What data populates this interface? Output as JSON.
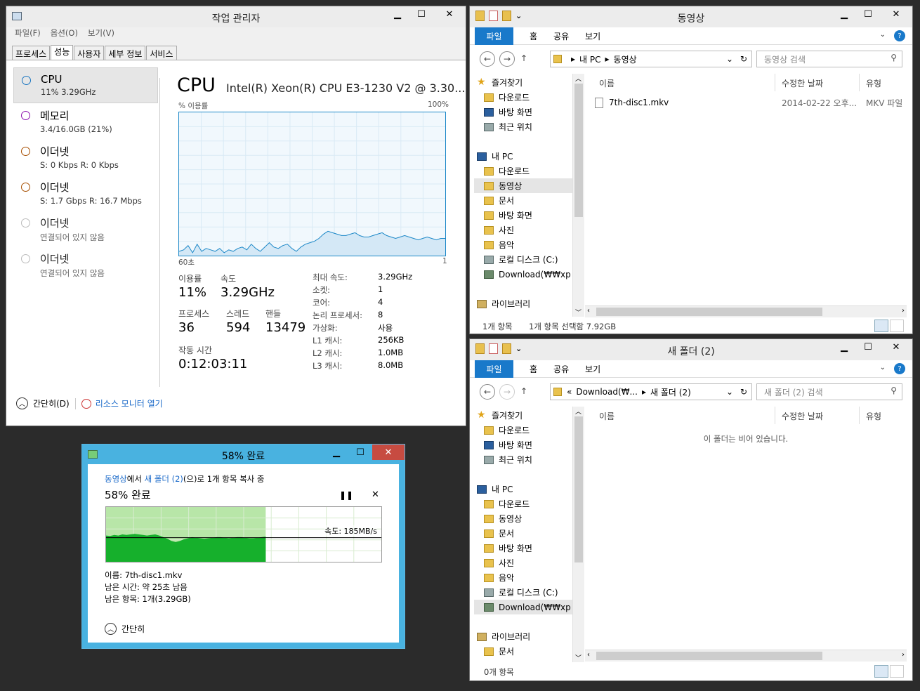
{
  "task_manager": {
    "title": "작업 관리자",
    "menu": [
      "파일(F)",
      "옵션(O)",
      "보기(V)"
    ],
    "tabs": [
      "프로세스",
      "성능",
      "사용자",
      "세부 정보",
      "서비스"
    ],
    "active_tab": "성능",
    "side": [
      {
        "name": "CPU",
        "sub": "11% 3.29GHz",
        "color": "#1874c0"
      },
      {
        "name": "메모리",
        "sub": "3.4/16.0GB (21%)",
        "color": "#8b12ae"
      },
      {
        "name": "이더넷",
        "sub": "S: 0 Kbps R: 0 Kbps",
        "color": "#a74f01"
      },
      {
        "name": "이더넷",
        "sub": "S: 1.7 Gbps R: 16.7 Mbps",
        "color": "#a74f01"
      },
      {
        "name": "이더넷",
        "sub": "연결되어 있지 않음",
        "color": "#bbbbbb"
      },
      {
        "name": "이더넷",
        "sub": "연결되어 있지 않음",
        "color": "#bbbbbb"
      }
    ],
    "cpu_title": "CPU",
    "cpu_model": "Intel(R) Xeon(R) CPU E3-1230 V2 @ 3.30...",
    "graph_label_left": "% 이용률",
    "graph_label_right": "100%",
    "graph_bottom_left": "60초",
    "graph_bottom_right": "1",
    "cpu_usage_history": [
      3,
      4,
      7,
      2,
      8,
      3,
      5,
      4,
      3,
      5,
      2,
      4,
      3,
      5,
      6,
      4,
      8,
      5,
      3,
      6,
      9,
      6,
      5,
      7,
      8,
      5,
      3,
      6,
      8,
      9,
      10,
      12,
      15,
      17,
      16,
      15,
      14,
      14,
      15,
      16,
      14,
      13,
      13,
      14,
      15,
      16,
      14,
      13,
      12,
      13,
      14,
      13,
      12,
      11,
      12,
      13,
      12,
      11,
      12,
      12
    ],
    "usage_label": "이용률",
    "usage_value": "11%",
    "speed_label": "속도",
    "speed_value": "3.29GHz",
    "proc_label": "프로세스",
    "proc_value": "36",
    "thread_label": "스레드",
    "thread_value": "594",
    "handle_label": "핸들",
    "handle_value": "13479",
    "uptime_label": "작동 시간",
    "uptime_value": "0:12:03:11",
    "specs_keys": [
      "최대 속도:",
      "소켓:",
      "코어:",
      "논리 프로세서:",
      "가상화:",
      "L1 캐시:",
      "L2 캐시:",
      "L3 캐시:"
    ],
    "specs_values": [
      "3.29GHz",
      "1",
      "4",
      "8",
      "사용",
      "256KB",
      "1.0MB",
      "8.0MB"
    ],
    "fewer_details": "간단히(D)",
    "resource_monitor": "리소스 모니터 열기"
  },
  "explorer1": {
    "title": "동영상",
    "ribbon": {
      "file": "파일",
      "tabs": [
        "홈",
        "공유",
        "보기"
      ]
    },
    "address": [
      "내 PC",
      "동영상"
    ],
    "search_placeholder": "동영상 검색",
    "nav": [
      {
        "label": "즐겨찾기",
        "icon": "star-icon",
        "indent": 0
      },
      {
        "label": "다운로드",
        "icon": "downloads-folder-icon",
        "indent": 1
      },
      {
        "label": "바탕 화면",
        "icon": "desktop-icon",
        "indent": 1
      },
      {
        "label": "최근 위치",
        "icon": "recent-places-icon",
        "indent": 1
      },
      {
        "label": "",
        "icon": "",
        "indent": 0
      },
      {
        "label": "내 PC",
        "icon": "pc-icon",
        "indent": 0
      },
      {
        "label": "다운로드",
        "icon": "downloads-folder-icon",
        "indent": 1
      },
      {
        "label": "동영상",
        "icon": "videos-folder-icon",
        "indent": 1,
        "selected": true
      },
      {
        "label": "문서",
        "icon": "documents-folder-icon",
        "indent": 1
      },
      {
        "label": "바탕 화면",
        "icon": "desktop-folder-icon",
        "indent": 1
      },
      {
        "label": "사진",
        "icon": "pictures-folder-icon",
        "indent": 1
      },
      {
        "label": "음악",
        "icon": "music-folder-icon",
        "indent": 1
      },
      {
        "label": "로컬 디스크 (C:)",
        "icon": "drive-icon",
        "indent": 1
      },
      {
        "label": "Download(₩₩xp",
        "icon": "network-drive-icon",
        "indent": 1
      },
      {
        "label": "",
        "icon": "",
        "indent": 0
      },
      {
        "label": "라이브러리",
        "icon": "library-icon",
        "indent": 0
      }
    ],
    "columns": [
      "이름",
      "수정한 날짜",
      "유형"
    ],
    "files": [
      {
        "name": "7th-disc1.mkv",
        "date": "2014-02-22 오후...",
        "type": "MKV 파일"
      }
    ],
    "status_count": "1개 항목",
    "status_selected": "1개 항목 선택함 7.92GB"
  },
  "explorer2": {
    "title": "새 폴더 (2)",
    "ribbon": {
      "file": "파일",
      "tabs": [
        "홈",
        "공유",
        "보기"
      ]
    },
    "address": [
      "«",
      "Download(₩...",
      "새 폴더 (2)"
    ],
    "search_placeholder": "새 폴더 (2) 검색",
    "nav": [
      {
        "label": "즐겨찾기",
        "icon": "star-icon",
        "indent": 0
      },
      {
        "label": "다운로드",
        "icon": "downloads-folder-icon",
        "indent": 1
      },
      {
        "label": "바탕 화면",
        "icon": "desktop-icon",
        "indent": 1
      },
      {
        "label": "최근 위치",
        "icon": "recent-places-icon",
        "indent": 1
      },
      {
        "label": "",
        "icon": "",
        "indent": 0
      },
      {
        "label": "내 PC",
        "icon": "pc-icon",
        "indent": 0
      },
      {
        "label": "다운로드",
        "icon": "downloads-folder-icon",
        "indent": 1
      },
      {
        "label": "동영상",
        "icon": "videos-folder-icon",
        "indent": 1
      },
      {
        "label": "문서",
        "icon": "documents-folder-icon",
        "indent": 1
      },
      {
        "label": "바탕 화면",
        "icon": "desktop-folder-icon",
        "indent": 1
      },
      {
        "label": "사진",
        "icon": "pictures-folder-icon",
        "indent": 1
      },
      {
        "label": "음악",
        "icon": "music-folder-icon",
        "indent": 1
      },
      {
        "label": "로컬 디스크 (C:)",
        "icon": "drive-icon",
        "indent": 1
      },
      {
        "label": "Download(₩₩xp",
        "icon": "network-drive-icon",
        "indent": 1,
        "selected": true
      },
      {
        "label": "",
        "icon": "",
        "indent": 0
      },
      {
        "label": "라이브러리",
        "icon": "library-icon",
        "indent": 0
      },
      {
        "label": "문서",
        "icon": "documents-folder-icon",
        "indent": 1
      }
    ],
    "columns": [
      "이름",
      "수정한 날짜",
      "유형"
    ],
    "empty_message": "이 폴더는 비어 있습니다.",
    "status_count": "0개 항목"
  },
  "copy_dialog": {
    "title": "58% 완료",
    "src": "동영상",
    "src_suffix": "에서 ",
    "dst": "새 폴더 (2)",
    "dst_suffix": "(으)로 1개 항목 복사 중",
    "progress_title": "58% 완료",
    "progress_fraction": 0.58,
    "speed": "속도: 185MB/s",
    "throughput_history": [
      0.52,
      0.53,
      0.51,
      0.52,
      0.5,
      0.51,
      0.5,
      0.49,
      0.5,
      0.51,
      0.52,
      0.51,
      0.5,
      0.52,
      0.55,
      0.58,
      0.62,
      0.64,
      0.62,
      0.59,
      0.57,
      0.55,
      0.56,
      0.57,
      0.58,
      0.57,
      0.56,
      0.55,
      0.55,
      0.56,
      0.57,
      0.56,
      0.55,
      0.55,
      0.56,
      0.57,
      0.57,
      0.56,
      0.55,
      0.54
    ],
    "name_line": "이름: 7th-disc1.mkv",
    "time_line": "남은 시간: 약 25초 남음",
    "items_line": "남은 항목: 1개(3.29GB)",
    "fewer": "간단히"
  }
}
